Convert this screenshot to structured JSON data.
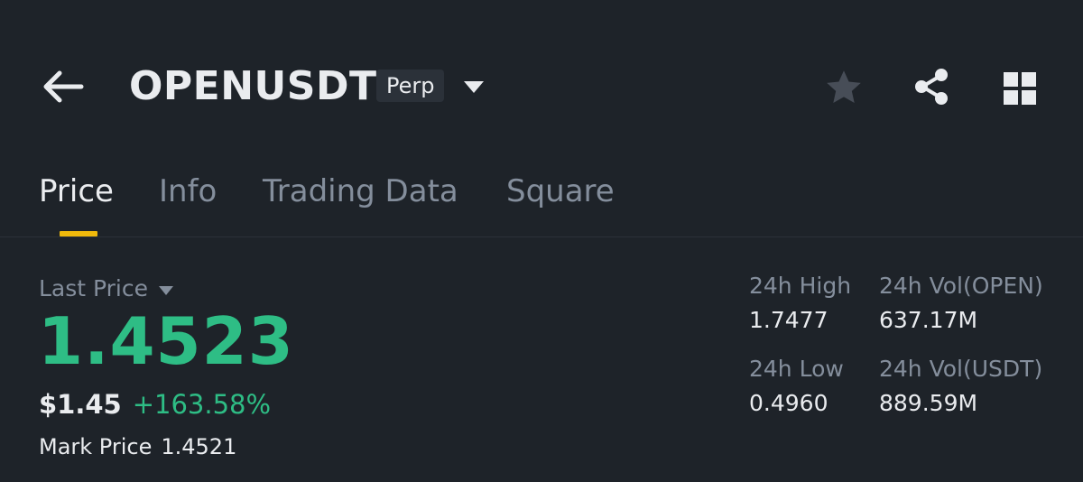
{
  "header": {
    "symbol": "OPENUSDT",
    "contract_badge": "Perp",
    "icons": {
      "back": "back-arrow-icon",
      "dropdown": "caret-down-icon",
      "favorite": "star-icon",
      "share": "share-icon",
      "more": "grid-icon"
    }
  },
  "tabs": [
    {
      "label": "Price",
      "active": true
    },
    {
      "label": "Info",
      "active": false
    },
    {
      "label": "Trading Data",
      "active": false
    },
    {
      "label": "Square",
      "active": false
    }
  ],
  "price": {
    "label": "Last Price",
    "value": "1.4523",
    "usd_value": "$1.45",
    "change_pct": "+163.58%",
    "mark_label": "Mark Price",
    "mark_value": "1.4521"
  },
  "stats": {
    "high_label": "24h High",
    "high_value": "1.7477",
    "low_label": "24h Low",
    "low_value": "0.4960",
    "vol_base_label": "24h Vol(OPEN)",
    "vol_base_value": "637.17M",
    "vol_quote_label": "24h Vol(USDT)",
    "vol_quote_value": "889.59M"
  },
  "colors": {
    "background": "#1e2329",
    "positive": "#2ebd85",
    "accent": "#f0b90b",
    "muted_text": "#848e9c",
    "primary_text": "#eaecef"
  }
}
